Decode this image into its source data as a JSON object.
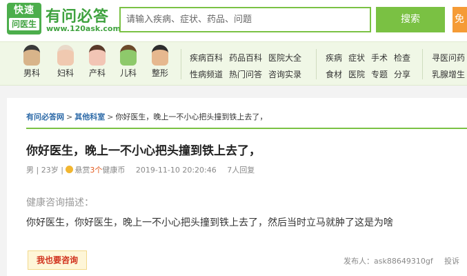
{
  "header": {
    "logo_badge_top": "快速",
    "logo_badge_bottom": "问医生",
    "logo_title": "有问必答",
    "logo_url": "www.120ask.com",
    "search_placeholder": "请输入疾病、症状、药品、问题",
    "search_button": "搜索",
    "extra_button": "免"
  },
  "nav": {
    "categories": [
      {
        "label": "男科",
        "icon": "male-doctor-icon"
      },
      {
        "label": "妇科",
        "icon": "female-doctor-icon"
      },
      {
        "label": "产科",
        "icon": "pregnant-icon"
      },
      {
        "label": "儿科",
        "icon": "child-icon"
      },
      {
        "label": "整形",
        "icon": "cosmetic-icon"
      }
    ],
    "group1": [
      "疾病百科",
      "药品百科",
      "医院大全",
      "性病频道",
      "热门问答",
      "咨询实录"
    ],
    "group2": [
      "疾病",
      "症状",
      "手术",
      "检查",
      "食材",
      "医院",
      "专题",
      "分享"
    ],
    "group3": [
      "寻医问药",
      "乳腺增生"
    ]
  },
  "breadcrumb": {
    "home": "有问必答网",
    "category": "其他科室",
    "current": "你好医生，晚上一不小心把头撞到铁上去了，"
  },
  "question": {
    "title": "你好医生，晚上一不小心把头撞到铁上去了，",
    "gender_age": "男 | 23岁",
    "reward_prefix": "悬赏",
    "reward_amount": "3个",
    "reward_suffix": "健康币",
    "time": "2019-11-10 20:20:46",
    "replies": "7人回复",
    "desc_label": "健康咨询描述：",
    "desc_text": "你好医生，你好医生，晚上一不小心把头撞到铁上去了，然后当时立马就肿了这是为啥"
  },
  "actions": {
    "consult_button": "我也要咨询",
    "poster_label": "发布人：",
    "poster_name": "ask88649310gf",
    "complain": "投诉"
  },
  "colors": {
    "brand_green": "#7ac143",
    "logo_green": "#3fa23f",
    "link_blue": "#2d6aa8",
    "highlight_orange": "#e35a1d"
  }
}
